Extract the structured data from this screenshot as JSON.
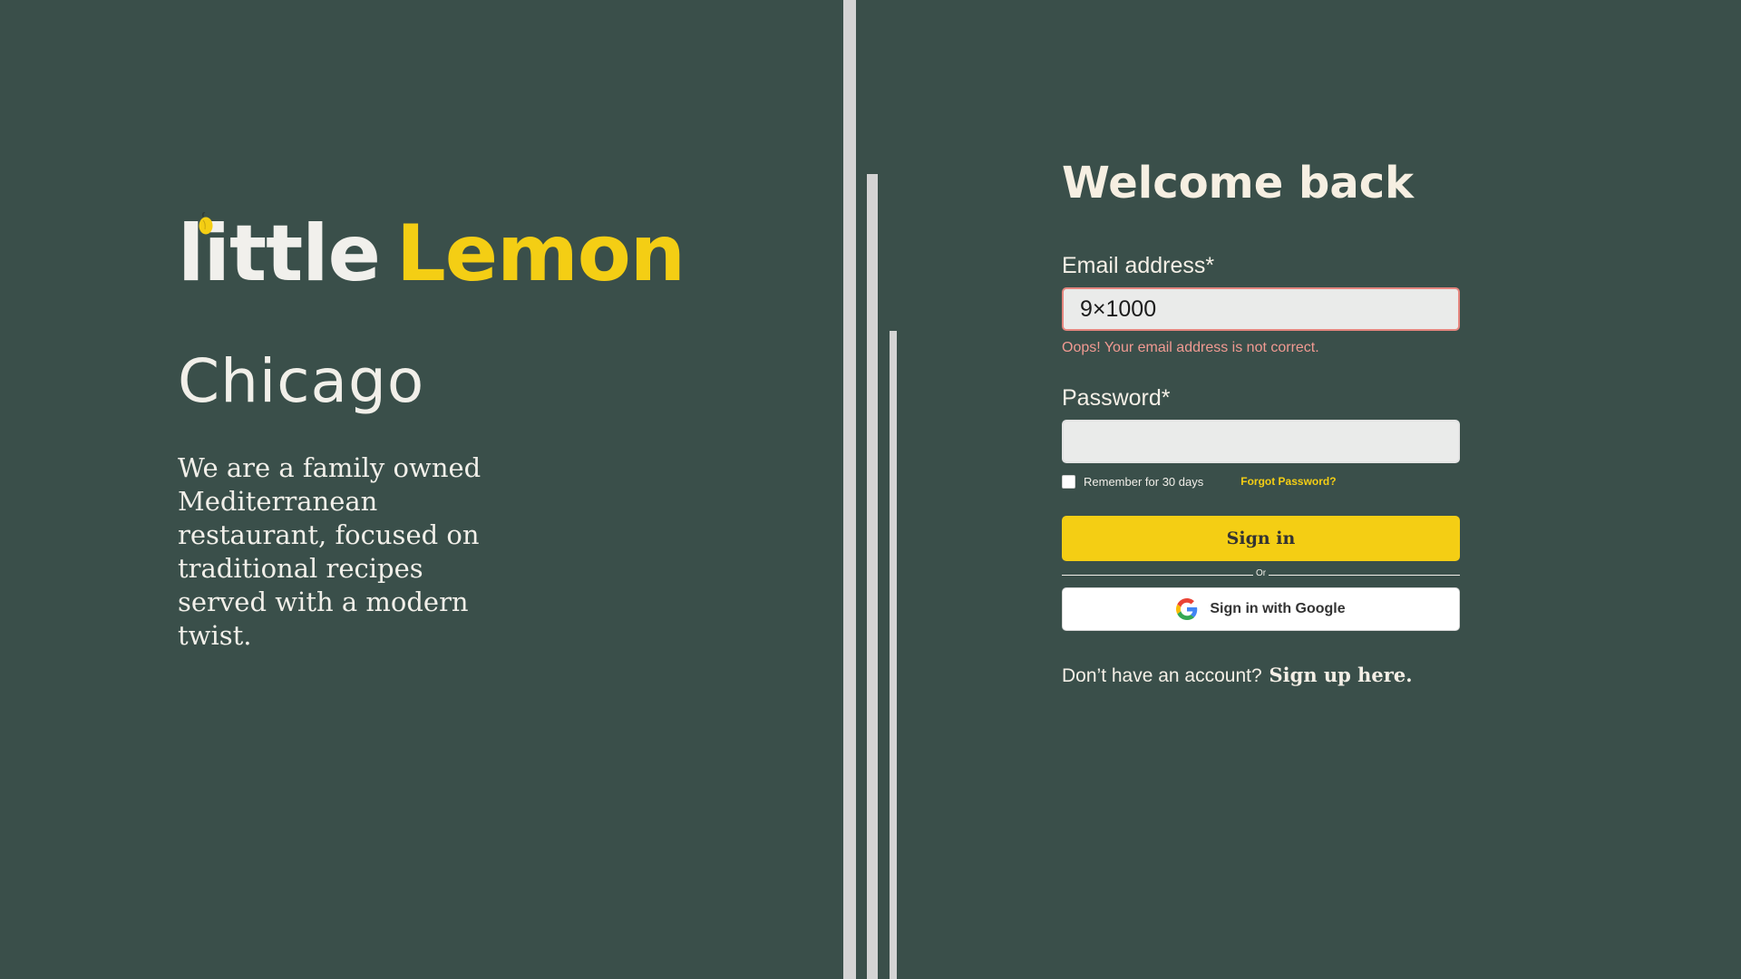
{
  "brand": {
    "word1": "little",
    "word2": "Lemon",
    "accent_color": "#f4ce14",
    "icon": "lemon-icon"
  },
  "hero": {
    "city": "Chicago",
    "description": "We are a family owned Mediterranean restaurant, focused on traditional recipes served with a modern twist."
  },
  "login": {
    "title": "Welcome back",
    "email": {
      "label": "Email address*",
      "value": "9×1000",
      "error": "Oops! Your email address is not correct."
    },
    "password": {
      "label": "Password*",
      "value": ""
    },
    "remember_label": "Remember for 30 days",
    "forgot_label": "Forgot Password?",
    "signin_label": "Sign in",
    "divider_label": "Or",
    "google_label": "Sign in with Google",
    "signup_prompt": "Don’t have an account?",
    "signup_link": "Sign up here."
  },
  "colors": {
    "background": "#3a4f4a",
    "primary_yellow": "#f4ce14",
    "error": "#f19a92",
    "input_bg": "#eaebea"
  }
}
